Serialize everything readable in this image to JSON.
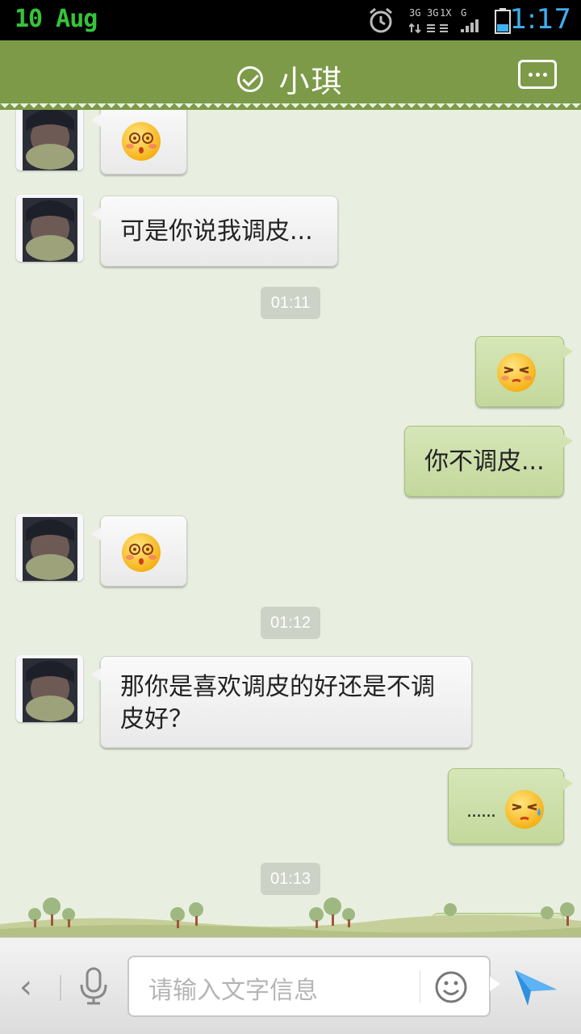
{
  "status_bar": {
    "date": "10 Aug",
    "time": "1:17",
    "network_labels": [
      "3G",
      "3G",
      "1X",
      "G"
    ],
    "icons": [
      "alarm-icon",
      "signal-icon",
      "battery-icon"
    ]
  },
  "header": {
    "title": "小琪",
    "icons": [
      "check-circle-icon",
      "more-options-icon"
    ],
    "accent_color": "#7c9a48"
  },
  "messages": [
    {
      "side": "in",
      "type": "emoji",
      "emoji": "dizzy-face-emoji"
    },
    {
      "side": "in",
      "type": "text",
      "text": "可是你说我调皮..."
    },
    {
      "side": "time",
      "text": "01:11"
    },
    {
      "side": "out",
      "type": "emoji",
      "emoji": "annoyed-face-emoji"
    },
    {
      "side": "out",
      "type": "text",
      "text": "你不调皮..."
    },
    {
      "side": "in",
      "type": "emoji",
      "emoji": "dizzy-face-emoji"
    },
    {
      "side": "time",
      "text": "01:12"
    },
    {
      "side": "in",
      "type": "text",
      "text": "那你是喜欢调皮的好还是不调皮好？"
    },
    {
      "side": "out",
      "type": "text_emoji",
      "text": "......",
      "emoji": "sweat-face-emoji"
    },
    {
      "side": "time",
      "text": "01:13"
    }
  ],
  "input_bar": {
    "placeholder": "请输入文字信息",
    "icons": [
      "back-chevron-icon",
      "microphone-icon",
      "smiley-icon",
      "send-icon"
    ],
    "back_glyph": "‹"
  }
}
